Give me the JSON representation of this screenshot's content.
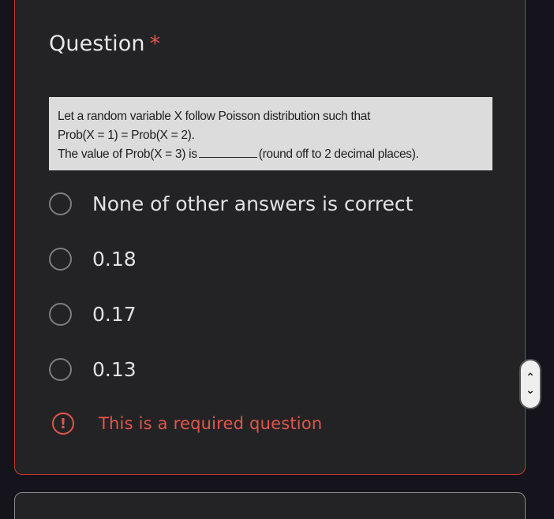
{
  "question": {
    "title": "Question",
    "required_marker": "*",
    "image_text": {
      "line1": "Let a random variable X follow Poisson distribution such that",
      "line2": "Prob(X = 1) = Prob(X = 2).",
      "line3_start": "The value of Prob(X = 3) is",
      "line3_end": "(round off to 2 decimal places)."
    },
    "options": [
      {
        "label": "None of other answers is correct"
      },
      {
        "label": "0.18"
      },
      {
        "label": "0.17"
      },
      {
        "label": "0.13"
      }
    ],
    "error": {
      "icon": "exclamation-icon",
      "text": "This is a required question"
    }
  },
  "colors": {
    "background": "#15131c",
    "card": "#232325",
    "error_red": "#e0574a",
    "text": "#e2e2e4"
  },
  "scroll_control": {
    "up_icon": "chevron-up-icon",
    "down_icon": "chevron-down-icon"
  }
}
